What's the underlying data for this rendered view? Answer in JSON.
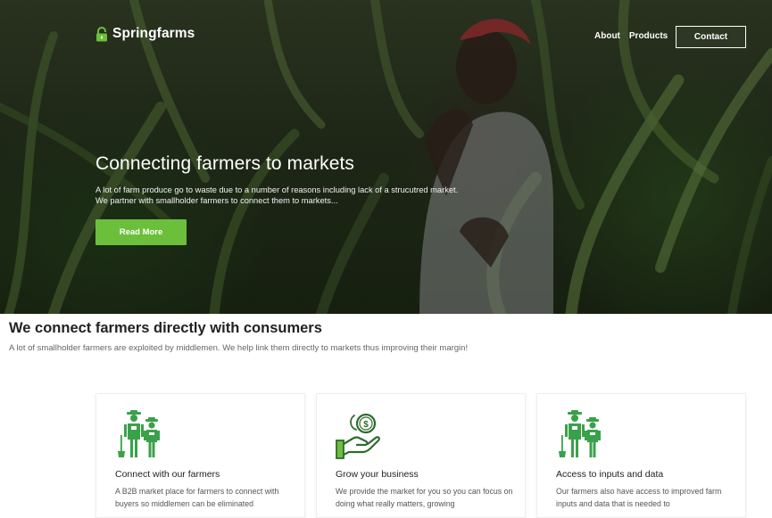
{
  "brand": {
    "name": "Springfarms",
    "icon": "unlocked-padlock-icon",
    "accent_color": "#6cbf3a"
  },
  "nav": {
    "links": [
      "About",
      "Products"
    ],
    "contact_label": "Contact"
  },
  "hero": {
    "title": "Connecting farmers to markets",
    "text": "A lot of farm produce go to waste due to a number of reasons including lack of a strucutred market. We partner with smallholder farmers to connect them to markets...",
    "button_label": "Read More"
  },
  "intro": {
    "title": "We connect farmers directly with consumers",
    "text": "A lot of smallholder farmers are exploited by middlemen. We help link them directly to markets thus improving their margin!"
  },
  "cards": [
    {
      "icon": "farmers-icon",
      "title": "Connect with our farmers",
      "text": "A B2B market place for farmers to connect with buyers so middlemen can be eliminated"
    },
    {
      "icon": "money-hand-icon",
      "title": "Grow your business",
      "text": "We provide the market for you so you can focus on doing what really matters, growing"
    },
    {
      "icon": "farmers-icon",
      "title": "Access to inputs and data",
      "text": "Our farmers also have access to improved farm inputs and data that is needed to"
    }
  ]
}
